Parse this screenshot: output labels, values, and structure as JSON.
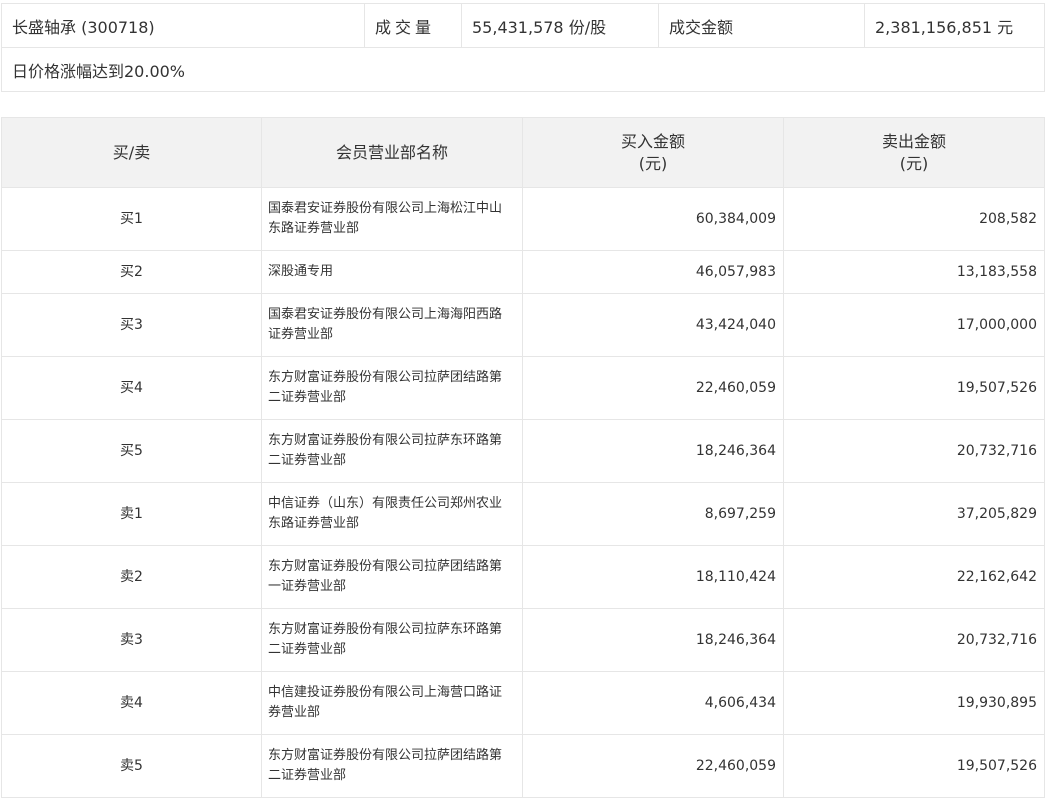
{
  "summary": {
    "stock": "长盛轴承 (300718)",
    "volume_label": "成交量",
    "volume_value": "55,431,578 份/股",
    "amount_label": "成交金额",
    "amount_value": "2,381,156,851 元",
    "reason": "日价格涨幅达到20.00%"
  },
  "table": {
    "headers": {
      "side": "买/卖",
      "name": "会员营业部名称",
      "buy_l1": "买入金额",
      "buy_l2": "(元)",
      "sell_l1": "卖出金额",
      "sell_l2": "(元)"
    },
    "rows": [
      {
        "side": "买1",
        "name": "国泰君安证券股份有限公司上海松江中山东路证券营业部",
        "buy": "60,384,009",
        "sell": "208,582"
      },
      {
        "side": "买2",
        "name": "深股通专用",
        "buy": "46,057,983",
        "sell": "13,183,558"
      },
      {
        "side": "买3",
        "name": "国泰君安证券股份有限公司上海海阳西路证券营业部",
        "buy": "43,424,040",
        "sell": "17,000,000"
      },
      {
        "side": "买4",
        "name": "东方财富证券股份有限公司拉萨团结路第二证券营业部",
        "buy": "22,460,059",
        "sell": "19,507,526"
      },
      {
        "side": "买5",
        "name": "东方财富证券股份有限公司拉萨东环路第二证券营业部",
        "buy": "18,246,364",
        "sell": "20,732,716"
      },
      {
        "side": "卖1",
        "name": "中信证券（山东）有限责任公司郑州农业东路证券营业部",
        "buy": "8,697,259",
        "sell": "37,205,829"
      },
      {
        "side": "卖2",
        "name": "东方财富证券股份有限公司拉萨团结路第一证券营业部",
        "buy": "18,110,424",
        "sell": "22,162,642"
      },
      {
        "side": "卖3",
        "name": "东方财富证券股份有限公司拉萨东环路第二证券营业部",
        "buy": "18,246,364",
        "sell": "20,732,716"
      },
      {
        "side": "卖4",
        "name": "中信建投证券股份有限公司上海营口路证券营业部",
        "buy": "4,606,434",
        "sell": "19,930,895"
      },
      {
        "side": "卖5",
        "name": "东方财富证券股份有限公司拉萨团结路第二证券营业部",
        "buy": "22,460,059",
        "sell": "19,507,526"
      }
    ]
  }
}
